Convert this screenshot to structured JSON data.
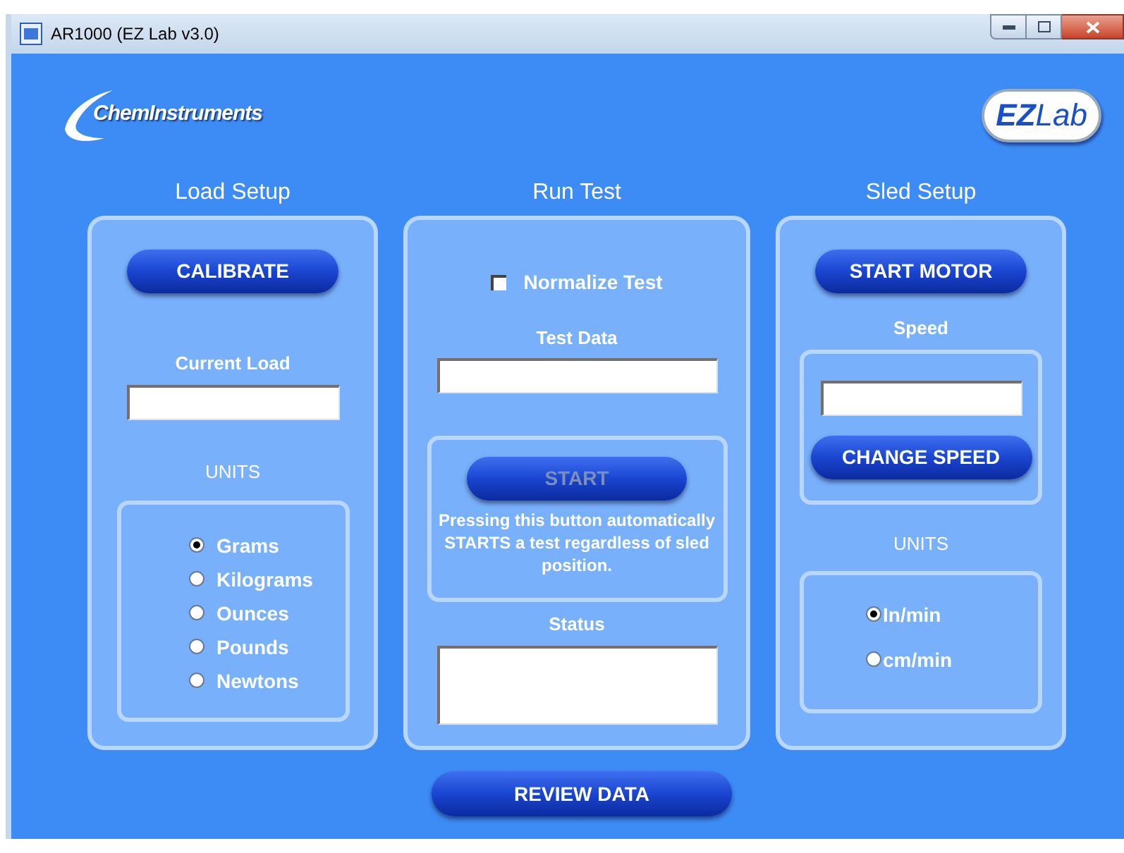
{
  "window": {
    "title": "AR1000 (EZ Lab v3.0)"
  },
  "logos": {
    "company": "ChemInstruments",
    "product_left": "EZ",
    "product_right": "Lab"
  },
  "load_setup": {
    "heading": "Load Setup",
    "calibrate_button": "CALIBRATE",
    "current_load_label": "Current Load",
    "units_label": "UNITS",
    "units": [
      {
        "label": "Grams",
        "selected": true
      },
      {
        "label": "Kilograms",
        "selected": false
      },
      {
        "label": "Ounces",
        "selected": false
      },
      {
        "label": "Pounds",
        "selected": false
      },
      {
        "label": "Newtons",
        "selected": false
      }
    ]
  },
  "run_test": {
    "heading": "Run Test",
    "normalize": {
      "label": "Normalize Test",
      "checked": false
    },
    "test_data_label": "Test Data",
    "start_button": {
      "label": "START",
      "disabled": true
    },
    "start_note": "Pressing this button automatically STARTS a test regardless of sled position.",
    "status_label": "Status"
  },
  "sled_setup": {
    "heading": "Sled Setup",
    "start_motor_button": "START MOTOR",
    "speed_label": "Speed",
    "change_speed_button": "CHANGE SPEED",
    "units_label": "UNITS",
    "units": [
      {
        "label": "In/min",
        "selected": true
      },
      {
        "label": "cm/min",
        "selected": false
      }
    ]
  },
  "review_button": "REVIEW DATA"
}
